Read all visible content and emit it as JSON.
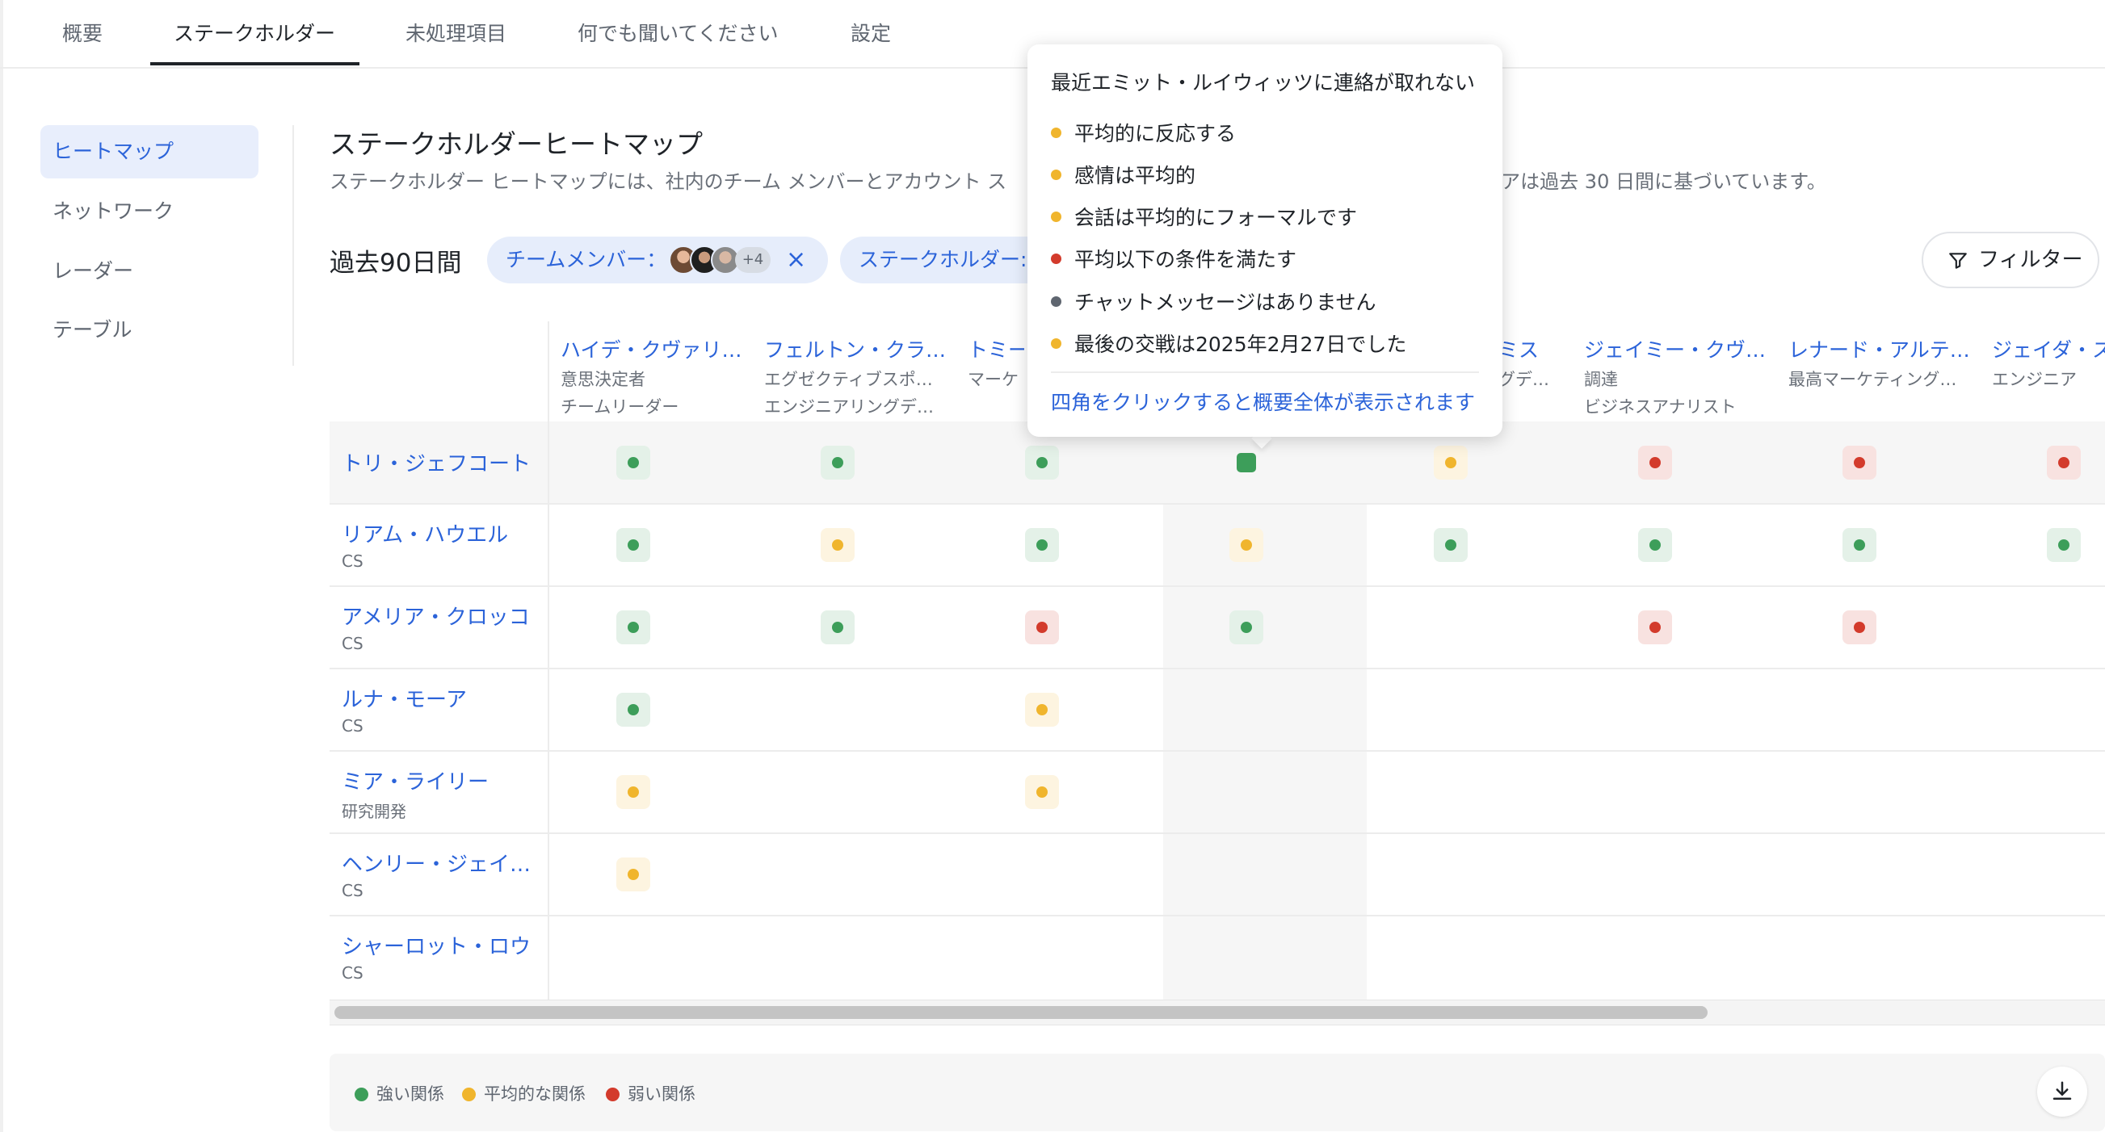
{
  "tabs": [
    {
      "label": "概要"
    },
    {
      "label": "ステークホルダー"
    },
    {
      "label": "未処理項目"
    },
    {
      "label": "何でも聞いてください"
    },
    {
      "label": "設定"
    }
  ],
  "sidebar": {
    "items": [
      {
        "label": "ヒートマップ"
      },
      {
        "label": "ネットワーク"
      },
      {
        "label": "レーダー"
      },
      {
        "label": "テーブル"
      }
    ]
  },
  "header": {
    "title": "ステークホルダーヒートマップ",
    "description": "ステークホルダー ヒートマップには、社内のチーム メンバーとアカウント ス",
    "description_tail": "コアは過去 30 日間に基づいています。",
    "period": "過去90日間"
  },
  "filters": {
    "team_chip": "チームメンバー：",
    "team_more": "+4",
    "clear": "×",
    "stakeholder_chip": "ステークホルダー:",
    "filter_button": "フィルター"
  },
  "columns": [
    {
      "name": "ハイデ・クヴァリ…",
      "line1": "意思決定者",
      "line2": "チームリーダー"
    },
    {
      "name": "フェルトン・クラ…",
      "line1": "エグゼクティブスポ…",
      "line2": "エンジニアリングデ…"
    },
    {
      "name": "トミー",
      "line1": "マーケ",
      "line2": ""
    },
    {
      "name": "",
      "line1": "",
      "line2": ""
    },
    {
      "name": "ミス",
      "line1": "グデ…",
      "line2": ""
    },
    {
      "name": "ジェイミー・クヴ…",
      "line1": "調達",
      "line2": "ビジネスアナリスト"
    },
    {
      "name": "レナード・アルテ…",
      "line1": "最高マーケティング…",
      "line2": ""
    },
    {
      "name": "ジェイダ・ス",
      "line1": "エンジニア",
      "line2": ""
    }
  ],
  "rows": [
    {
      "name": "トリ・ジェフコート",
      "sub": "",
      "cells": [
        "strong",
        "strong",
        "strong",
        "sel",
        "avg",
        "weak",
        "weak",
        "weak"
      ]
    },
    {
      "name": "リアム・ハウエル",
      "sub": "CS",
      "cells": [
        "strong",
        "avg",
        "strong",
        "avg",
        "strong",
        "strong",
        "strong",
        "strong"
      ]
    },
    {
      "name": "アメリア・クロッコ",
      "sub": "CS",
      "cells": [
        "strong",
        "strong",
        "weak",
        "strong",
        "",
        "weak",
        "weak",
        ""
      ]
    },
    {
      "name": "ルナ・モーア",
      "sub": "CS",
      "cells": [
        "strong",
        "",
        "avg",
        "",
        "",
        "",
        "",
        ""
      ]
    },
    {
      "name": "ミア・ライリー",
      "sub": "研究開発",
      "cells": [
        "avg",
        "",
        "avg",
        "",
        "",
        "",
        "",
        ""
      ]
    },
    {
      "name": "ヘンリー・ジェイ…",
      "sub": "CS",
      "cells": [
        "avg",
        "",
        "",
        "",
        "",
        "",
        "",
        ""
      ]
    },
    {
      "name": "シャーロット・ロウ",
      "sub": "CS",
      "cells": [
        "",
        "",
        "",
        "",
        "",
        "",
        "",
        ""
      ]
    }
  ],
  "legend": {
    "strong": "強い関係",
    "average": "平均的な関係",
    "weak": "弱い関係"
  },
  "colors": {
    "strong": "#3d9e5a",
    "average": "#f0b52d",
    "weak": "#d33b2c",
    "none": "#5f6670",
    "accent": "#2b63d9"
  },
  "tooltip": {
    "title": "最近エミット・ルイウィッツに連絡が取れない",
    "items": [
      {
        "text": "平均的に反応する",
        "level": "average"
      },
      {
        "text": "感情は平均的",
        "level": "average"
      },
      {
        "text": "会話は平均的にフォーマルです",
        "level": "average"
      },
      {
        "text": "平均以下の条件を満たす",
        "level": "weak"
      },
      {
        "text": "チャットメッセージはありません",
        "level": "none"
      },
      {
        "text": "最後の交戦は2025年2月27日でした",
        "level": "average"
      }
    ],
    "link": "四角をクリックすると概要全体が表示されます"
  }
}
